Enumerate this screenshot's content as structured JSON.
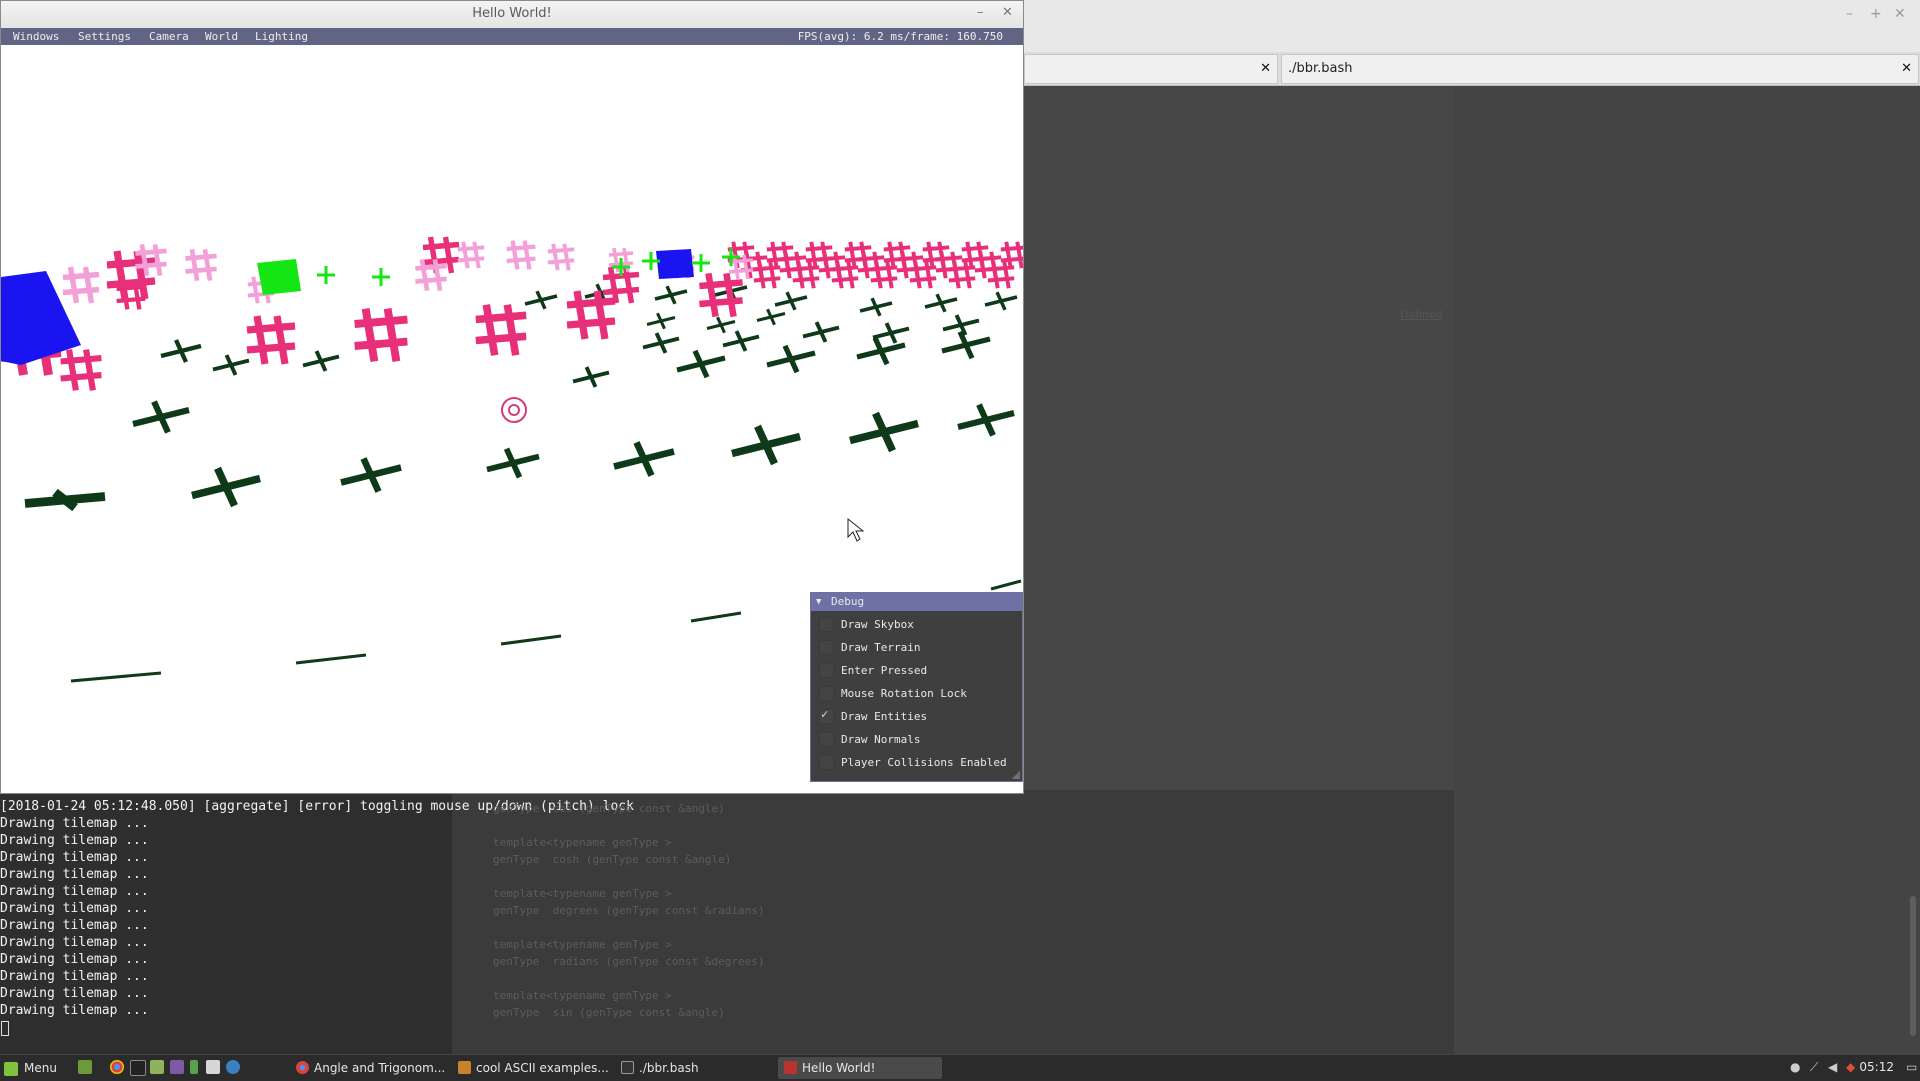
{
  "game_window": {
    "title": "Hello World!",
    "minimize_glyph": "–",
    "close_glyph": "✕",
    "menu": [
      "Windows",
      "Settings",
      "Camera",
      "World",
      "Lighting"
    ],
    "fps_text": "FPS(avg): 6.2 ms/frame: 160.750"
  },
  "debug_panel": {
    "title": "Debug",
    "items": [
      {
        "label": "Draw Skybox",
        "checked": false
      },
      {
        "label": "Draw Terrain",
        "checked": false
      },
      {
        "label": "Enter Pressed",
        "checked": false
      },
      {
        "label": "Mouse Rotation Lock",
        "checked": false
      },
      {
        "label": "Draw Entities",
        "checked": true
      },
      {
        "label": "Draw Normals",
        "checked": false
      },
      {
        "label": "Player Collisions Enabled",
        "checked": false
      }
    ],
    "check_glyph": "✓"
  },
  "terminal": {
    "lines": [
      "[2018-01-24 05:12:48.050] [aggregate] [error] toggling mouse up/down (pitch) lock",
      "Drawing tilemap ...",
      "Drawing tilemap ...",
      "Drawing tilemap ...",
      "Drawing tilemap ...",
      "Drawing tilemap ...",
      "Drawing tilemap ...",
      "Drawing tilemap ...",
      "Drawing tilemap ...",
      "Drawing tilemap ...",
      "Drawing tilemap ...",
      "Drawing tilemap ...",
      "Drawing tilemap ..."
    ]
  },
  "code_snippet": {
    "lines": [
      "genType  cos (genType const &angle)",
      "",
      "template<typename genType >",
      "genType  cosh (genType const &angle)",
      "",
      "template<typename genType >",
      "genType  degrees (genType const &radians)",
      "",
      "template<typename genType >",
      "genType  radians (genType const &degrees)",
      "",
      "template<typename genType >",
      "genType  sin (genType const &angle)"
    ]
  },
  "background_terminal": {
    "tabs": [
      {
        "label": "",
        "close": "✕"
      },
      {
        "label": "./bbr.bash",
        "close": "✕"
      }
    ],
    "window_buttons": [
      "–",
      "+",
      "✕"
    ],
    "faint_link": "Defined"
  },
  "taskbar": {
    "menu_label": "Menu",
    "tasks": [
      {
        "label": "Angle and Trigonom...",
        "icon": "chrome-icon",
        "color": "#d9472b"
      },
      {
        "label": "cool ASCII examples...",
        "icon": "image-viewer-icon",
        "color": "#c9812b"
      },
      {
        "label": "./bbr.bash",
        "icon": "terminal-icon",
        "color": "#333333"
      },
      {
        "label": "Hello World!",
        "icon": "app-icon",
        "color": "#b5352e"
      }
    ],
    "clock": "05:12"
  },
  "scene": {
    "description_colors": {
      "background": "#ffffff",
      "dark_plus": "#0f3a1a",
      "pink_hash": "#e8307a",
      "light_pink": "#f4a0d8",
      "green_cube": "#14e614",
      "blue_cube": "#1a14f0"
    }
  }
}
